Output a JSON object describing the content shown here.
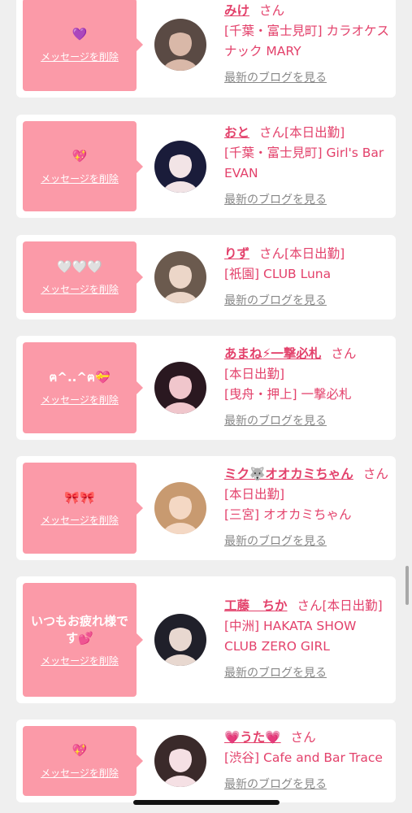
{
  "colors": {
    "accent": "#e3416b",
    "bubble": "#fb9aa8",
    "link_gray": "#888888",
    "card": "#ffffff",
    "background": "#efefef"
  },
  "delete_label": "メッセージを削除",
  "blog_label": "最新のブログを見る",
  "san_label": "さん",
  "cards": [
    {
      "message": "💜",
      "name": "みけ",
      "suffix": "",
      "lines": [
        "[千葉・富士見町] カラオケスナック MARY"
      ],
      "avatar_icon": "girl-avatar"
    },
    {
      "message": "💖",
      "name": "おと",
      "suffix": "[本日出勤]",
      "lines": [
        "[千葉・富士見町] Girl's Bar EVAN"
      ],
      "avatar_icon": "girl-avatar"
    },
    {
      "message": "🤍🤍🤍",
      "name": "りず",
      "suffix": "[本日出勤]",
      "lines": [
        "[祇園] CLUB Luna"
      ],
      "avatar_icon": "girl-avatar"
    },
    {
      "message": "ฅ^..^ฅ💝",
      "name": "あまね⚡一撃必札",
      "suffix": "",
      "lines": [
        "[本日出勤]",
        "[曳舟・押上] 一撃必札"
      ],
      "avatar_icon": "girl-avatar"
    },
    {
      "message": "🎀🎀",
      "name": "ミク🐺オオカミちゃん",
      "suffix": "[本日出勤]",
      "lines": [
        "[三宮] オオカミちゃん"
      ],
      "avatar_icon": "girl-avatar"
    },
    {
      "message": "いつもお疲れ様です💕",
      "name": "工藤　ちか",
      "suffix": "[本日出勤]",
      "lines": [
        "[中洲] HAKATA SHOW CLUB ZERO GIRL"
      ],
      "avatar_icon": "girl-avatar"
    },
    {
      "message": "💖",
      "name": "💗うた💗",
      "suffix": "",
      "lines": [
        "[渋谷] Cafe and Bar Trace"
      ],
      "avatar_icon": "girl-avatar"
    }
  ]
}
